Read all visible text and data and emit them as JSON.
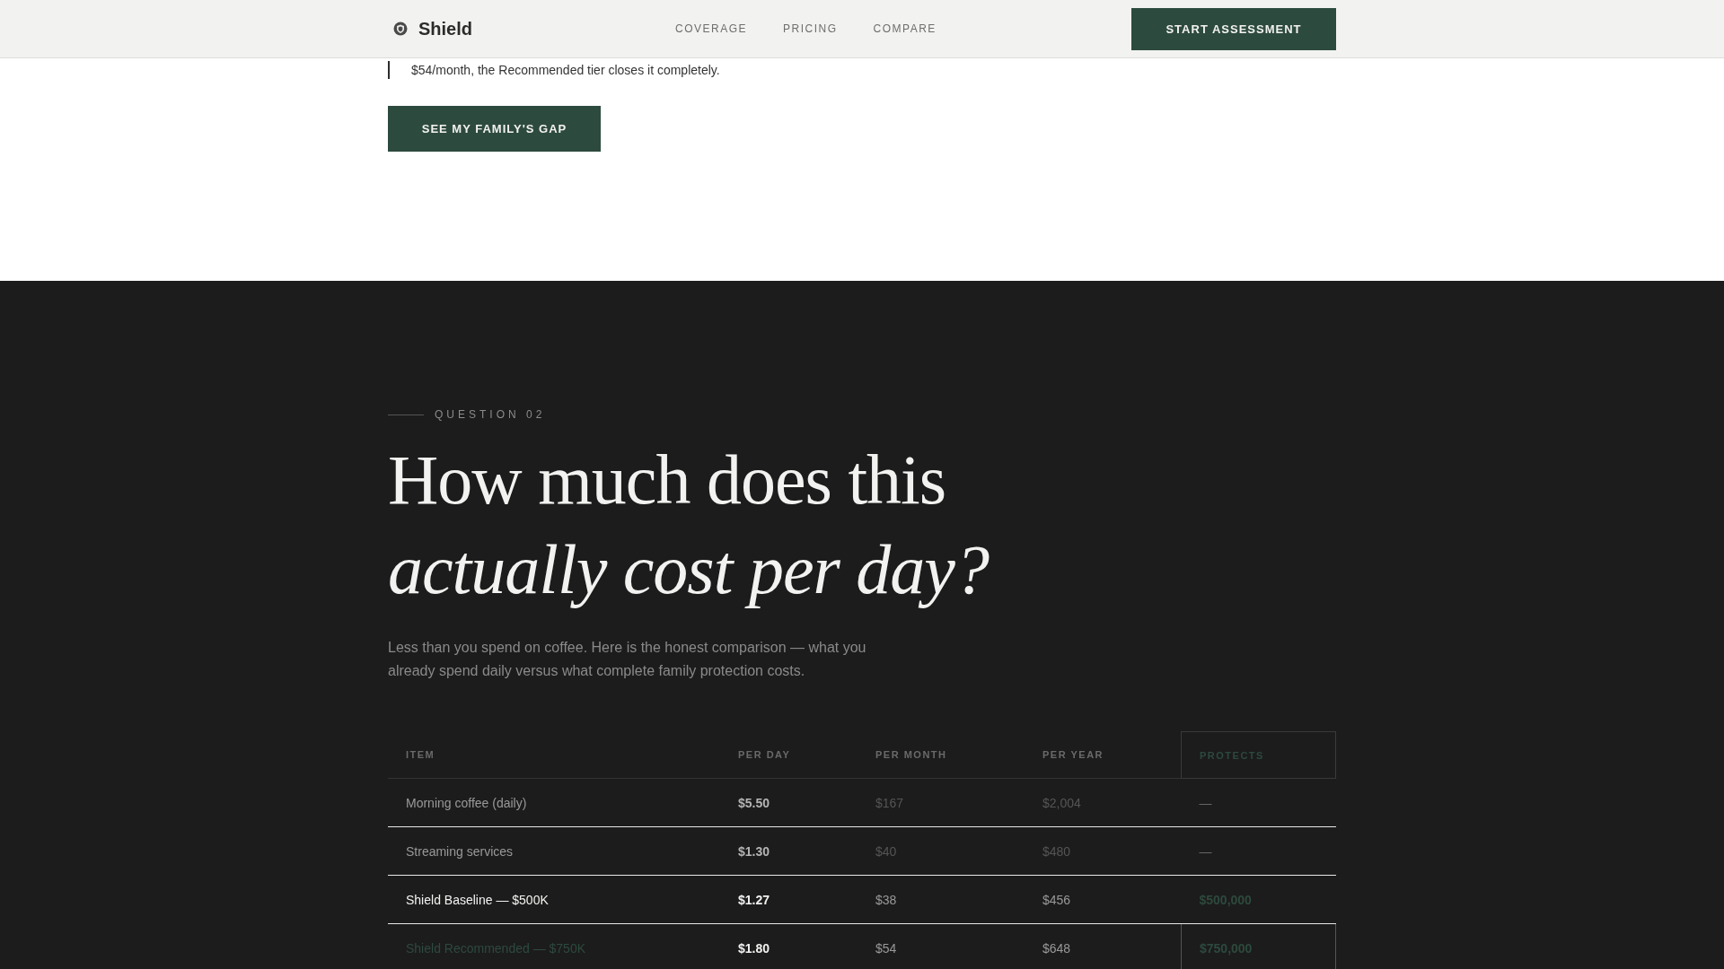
{
  "header": {
    "brand": "Shield",
    "nav": [
      "COVERAGE",
      "PRICING",
      "COMPARE"
    ],
    "cta": "START ASSESSMENT"
  },
  "intro": {
    "quote_tail": "$54/month, the Recommended tier closes it completely.",
    "button": "SEE MY FAMILY'S GAP"
  },
  "question": {
    "eyebrow": "QUESTION 02",
    "title_line_1": "How much does this",
    "title_line_2": "actually cost per day?",
    "lede": "Less than you spend on coffee. Here is the honest comparison — what you already spend daily versus what complete family protection costs."
  },
  "table": {
    "columns": [
      {
        "label": "ITEM",
        "highlighted": false
      },
      {
        "label": "PER DAY",
        "highlighted": false
      },
      {
        "label": "PER MONTH",
        "highlighted": false
      },
      {
        "label": "PER YEAR",
        "highlighted": false
      },
      {
        "label": "PROTECTS",
        "highlighted": true
      }
    ],
    "rows": [
      {
        "kind": "expense",
        "highlighted": false,
        "cells": [
          "Morning coffee (daily)",
          "$5.50",
          "$167",
          "$2,004",
          "—"
        ]
      },
      {
        "kind": "expense",
        "highlighted": false,
        "cells": [
          "Streaming services",
          "$1.30",
          "$40",
          "$480",
          "—"
        ]
      },
      {
        "kind": "plan",
        "highlighted": false,
        "cells": [
          "Shield Baseline — $500K",
          "$1.27",
          "$38",
          "$456",
          "$500,000"
        ]
      },
      {
        "kind": "recommended",
        "highlighted": true,
        "cells": [
          "Shield Recommended — $750K",
          "$1.80",
          "$54",
          "$648",
          "$750,000"
        ]
      }
    ]
  }
}
